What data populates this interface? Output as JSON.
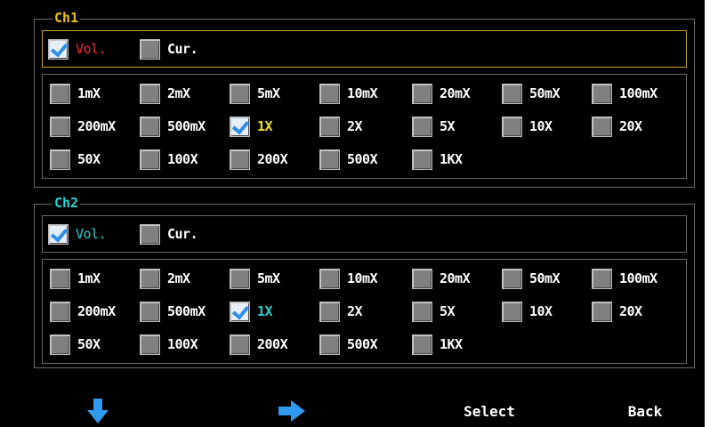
{
  "channels": [
    {
      "id": "ch1",
      "name": "Ch1",
      "color": "#e8c21c",
      "mode_active": true,
      "modes": [
        {
          "label": "Vol.",
          "checked": true,
          "color": "#ff2a2a"
        },
        {
          "label": "Cur.",
          "checked": false,
          "color": "#ffffff"
        }
      ],
      "probe_options": [
        {
          "label": "1mX",
          "checked": false
        },
        {
          "label": "2mX",
          "checked": false
        },
        {
          "label": "5mX",
          "checked": false
        },
        {
          "label": "10mX",
          "checked": false
        },
        {
          "label": "20mX",
          "checked": false
        },
        {
          "label": "50mX",
          "checked": false
        },
        {
          "label": "100mX",
          "checked": false
        },
        {
          "label": "200mX",
          "checked": false
        },
        {
          "label": "500mX",
          "checked": false
        },
        {
          "label": "1X",
          "checked": true,
          "color": "#f3e21a"
        },
        {
          "label": "2X",
          "checked": false
        },
        {
          "label": "5X",
          "checked": false
        },
        {
          "label": "10X",
          "checked": false
        },
        {
          "label": "20X",
          "checked": false
        },
        {
          "label": "50X",
          "checked": false
        },
        {
          "label": "100X",
          "checked": false
        },
        {
          "label": "200X",
          "checked": false
        },
        {
          "label": "500X",
          "checked": false
        },
        {
          "label": "1KX",
          "checked": false
        }
      ]
    },
    {
      "id": "ch2",
      "name": "Ch2",
      "color": "#22d3d3",
      "mode_active": false,
      "modes": [
        {
          "label": "Vol.",
          "checked": true,
          "color": "#22d3d3"
        },
        {
          "label": "Cur.",
          "checked": false,
          "color": "#ffffff"
        }
      ],
      "probe_options": [
        {
          "label": "1mX",
          "checked": false
        },
        {
          "label": "2mX",
          "checked": false
        },
        {
          "label": "5mX",
          "checked": false
        },
        {
          "label": "10mX",
          "checked": false
        },
        {
          "label": "20mX",
          "checked": false
        },
        {
          "label": "50mX",
          "checked": false
        },
        {
          "label": "100mX",
          "checked": false
        },
        {
          "label": "200mX",
          "checked": false
        },
        {
          "label": "500mX",
          "checked": false
        },
        {
          "label": "1X",
          "checked": true,
          "color": "#22d3d3"
        },
        {
          "label": "2X",
          "checked": false
        },
        {
          "label": "5X",
          "checked": false
        },
        {
          "label": "10X",
          "checked": false
        },
        {
          "label": "20X",
          "checked": false
        },
        {
          "label": "50X",
          "checked": false
        },
        {
          "label": "100X",
          "checked": false
        },
        {
          "label": "200X",
          "checked": false
        },
        {
          "label": "500X",
          "checked": false
        },
        {
          "label": "1KX",
          "checked": false
        }
      ]
    }
  ],
  "softkeys": [
    {
      "type": "icon",
      "icon": "arrow-down-icon",
      "color": "#2f9bf0"
    },
    {
      "type": "icon",
      "icon": "arrow-right-icon",
      "color": "#2f9bf0"
    },
    {
      "type": "text",
      "label": "Select"
    },
    {
      "type": "text",
      "label": "Back"
    }
  ]
}
